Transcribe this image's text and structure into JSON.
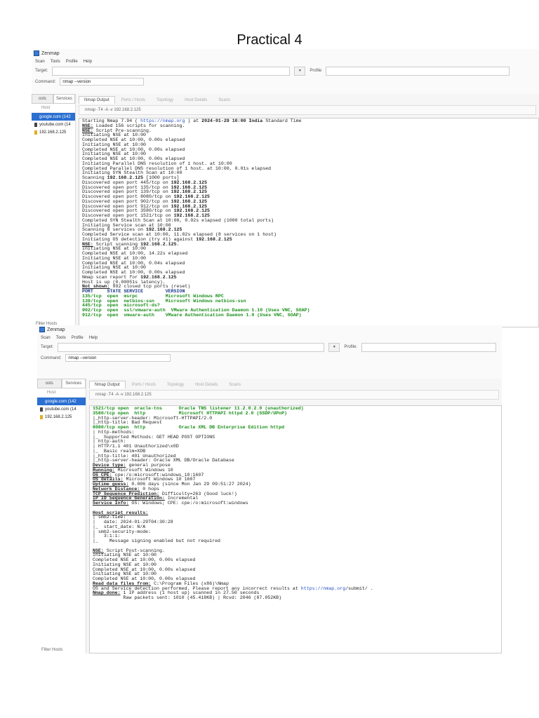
{
  "page_title": "Practical 4",
  "colors": {
    "selection": "#2a6fd1",
    "port_line": "#1a8f1a",
    "link": "#2350c8"
  },
  "screenshots": [
    {
      "window_title": "Zenmap",
      "menu": [
        "Scan",
        "Tools",
        "Profile",
        "Help"
      ],
      "target_label": "Target:",
      "target_value": "",
      "profile_label": "Profile",
      "command_label": "Command:",
      "command_value": "nmap --version",
      "left_tabs": [
        "osts",
        "Services"
      ],
      "host_header": "Host",
      "hosts": [
        {
          "name": "google.com (142",
          "selected": true,
          "icon_color": "#2a6fd1"
        },
        {
          "name": "youtube.com (14",
          "selected": false,
          "icon_color": "#444444"
        },
        {
          "name": "192.168.2.125",
          "selected": false,
          "icon_color": "#e0b020"
        }
      ],
      "filter_label": "Filter Hosts",
      "right_tabs": [
        "Nmap Output",
        "Ports / Hosts",
        "Topology",
        "Host Details",
        "Scans"
      ],
      "command_echo": "nmap -T4 -A -v 192.168.2.125",
      "output_lines": [
        {
          "s": [
            {
              "t": "Starting Nmap 7.94 ( "
            },
            {
              "t": "https://nmap.org",
              "c": "bl"
            },
            {
              "t": " ) at "
            },
            {
              "t": "2024-01-29 10:00 India",
              "c": "b"
            },
            {
              "t": " Standard Time"
            }
          ]
        },
        {
          "s": [
            {
              "t": "NSE:",
              "c": "u"
            },
            {
              "t": " Loaded 156 scripts for scanning."
            }
          ]
        },
        {
          "s": [
            {
              "t": "NSE:",
              "c": "u"
            },
            {
              "t": " Script Pre-scanning."
            }
          ]
        },
        {
          "s": [
            {
              "t": "Initiating NSE at 10:00"
            }
          ]
        },
        {
          "s": [
            {
              "t": "Completed NSE at 10:00, 0.00s elapsed"
            }
          ]
        },
        {
          "s": [
            {
              "t": "Initiating NSE at 10:00"
            }
          ]
        },
        {
          "s": [
            {
              "t": "Completed NSE at 10:00, 0.00s elapsed"
            }
          ]
        },
        {
          "s": [
            {
              "t": "Initiating NSE at 10:00"
            }
          ]
        },
        {
          "s": [
            {
              "t": "Completed NSE at 10:00, 0.00s elapsed"
            }
          ]
        },
        {
          "s": [
            {
              "t": "Initiating Parallel DNS resolution of 1 host. at 10:00"
            }
          ]
        },
        {
          "s": [
            {
              "t": "Completed Parallel DNS resolution of 1 host. at 10:00, 0.01s elapsed"
            }
          ]
        },
        {
          "s": [
            {
              "t": "Initiating SYN Stealth Scan at 10:00"
            }
          ]
        },
        {
          "s": [
            {
              "t": "Scanning "
            },
            {
              "t": "192.168.2.125",
              "c": "b"
            },
            {
              "t": " [1000 ports]"
            }
          ]
        },
        {
          "s": [
            {
              "t": "Discovered open port 445/tcp on "
            },
            {
              "t": "192.168.2.125",
              "c": "b"
            }
          ]
        },
        {
          "s": [
            {
              "t": "Discovered open port 135/tcp on "
            },
            {
              "t": "192.168.2.125",
              "c": "b"
            }
          ]
        },
        {
          "s": [
            {
              "t": "Discovered open port 139/tcp on "
            },
            {
              "t": "192.168.2.125",
              "c": "b"
            }
          ]
        },
        {
          "s": [
            {
              "t": "Discovered open port 8080/tcp on "
            },
            {
              "t": "192.168.2.125",
              "c": "b"
            }
          ]
        },
        {
          "s": [
            {
              "t": "Discovered open port 902/tcp on "
            },
            {
              "t": "192.168.2.125",
              "c": "b"
            }
          ]
        },
        {
          "s": [
            {
              "t": "Discovered open port 912/tcp on "
            },
            {
              "t": "192.168.2.125",
              "c": "b"
            }
          ]
        },
        {
          "s": [
            {
              "t": "Discovered open port 3580/tcp on "
            },
            {
              "t": "192.168.2.125",
              "c": "b"
            }
          ]
        },
        {
          "s": [
            {
              "t": "Discovered open port 1521/tcp on "
            },
            {
              "t": "192.168.2.125",
              "c": "b"
            }
          ]
        },
        {
          "s": [
            {
              "t": "Completed SYN Stealth Scan at 10:00, 0.02s elapsed (1000 total ports)"
            }
          ]
        },
        {
          "s": [
            {
              "t": "Initiating Service scan at 10:00"
            }
          ]
        },
        {
          "s": [
            {
              "t": "Scanning 8 services on "
            },
            {
              "t": "192.168.2.125",
              "c": "b"
            }
          ]
        },
        {
          "s": [
            {
              "t": "Completed Service scan at 10:00, 11.02s elapsed (8 services on 1 host)"
            }
          ]
        },
        {
          "s": [
            {
              "t": "Initiating OS detection (try #1) against "
            },
            {
              "t": "192.168.2.125",
              "c": "b"
            }
          ]
        },
        {
          "s": [
            {
              "t": "NSE:",
              "c": "u"
            },
            {
              "t": " Script scanning "
            },
            {
              "t": "192.168.2.125",
              "c": "b"
            },
            {
              "t": "."
            }
          ]
        },
        {
          "s": [
            {
              "t": "Initiating NSE at 10:00"
            }
          ]
        },
        {
          "s": [
            {
              "t": "Completed NSE at 10:00, 14.22s elapsed"
            }
          ]
        },
        {
          "s": [
            {
              "t": "Initiating NSE at 10:00"
            }
          ]
        },
        {
          "s": [
            {
              "t": "Completed NSE at 10:00, 0.04s elapsed"
            }
          ]
        },
        {
          "s": [
            {
              "t": "Initiating NSE at 10:00"
            }
          ]
        },
        {
          "s": [
            {
              "t": "Completed NSE at 10:00, 0.00s elapsed"
            }
          ]
        },
        {
          "s": [
            {
              "t": "Nmap scan report for "
            },
            {
              "t": "192.168.2.125",
              "c": "b"
            }
          ]
        },
        {
          "s": [
            {
              "t": "Host is up (0.00051s latency)."
            }
          ]
        },
        {
          "s": [
            {
              "t": "Not shown:",
              "c": "u"
            },
            {
              "t": " 992 closed tcp ports (reset)"
            }
          ]
        },
        {
          "s": [
            {
              "t": "PORT     STATE SERVICE        VERSION",
              "c": "blk"
            }
          ]
        },
        {
          "s": [
            {
              "t": "135/tcp  open  msrpc          Microsoft Windows RPC",
              "c": "g"
            }
          ]
        },
        {
          "s": [
            {
              "t": "139/tcp  open  netbios-ssn    Microsoft Windows netbios-ssn",
              "c": "g"
            }
          ]
        },
        {
          "s": [
            {
              "t": "445/tcp  open  microsoft-ds?",
              "c": "g"
            }
          ]
        },
        {
          "s": [
            {
              "t": "902/tcp  open  ssl/vmware-auth  VMware Authentication Daemon 1.10 (Uses VNC, SOAP)",
              "c": "g"
            }
          ]
        },
        {
          "s": [
            {
              "t": "912/tcp  open  vmware-auth    VMware Authentication Daemon 1.0 (Uses VNC, SOAP)",
              "c": "g"
            }
          ]
        }
      ]
    },
    {
      "window_title": "Zenmap",
      "menu": [
        "Scan",
        "Tools",
        "Profile",
        "Help"
      ],
      "target_label": "Target:",
      "target_value": "",
      "profile_label": "Profile:",
      "command_label": "Command:",
      "command_value": "nmap --version",
      "left_tabs": [
        "osts",
        "Services"
      ],
      "host_header": "Host",
      "hosts": [
        {
          "name": "google.com (142",
          "selected": true,
          "icon_color": "#2a6fd1"
        },
        {
          "name": "youtube.com (14",
          "selected": false,
          "icon_color": "#444444"
        },
        {
          "name": "192.168.2.125",
          "selected": false,
          "icon_color": "#e0b020"
        }
      ],
      "filter_label": "Filter Hosts",
      "right_tabs": [
        "Nmap Output",
        "Ports / Hosts",
        "Topology",
        "Host Details",
        "Scans"
      ],
      "command_echo": "nmap -T4 -A -v 192.168.2.125",
      "output_lines": [
        {
          "s": [
            {
              "t": "1521/tcp open  oracle-tns      Oracle TNS listener 11.2.0.2.0 (unauthorized)",
              "c": "g"
            }
          ]
        },
        {
          "s": [
            {
              "t": "3580/tcp open  http            Microsoft HTTPAPI httpd 2.0 (SSDP/UPnP)",
              "c": "g"
            }
          ]
        },
        {
          "s": [
            {
              "t": "|_http-server-header: Microsoft-HTTPAPI/2.0"
            }
          ]
        },
        {
          "s": [
            {
              "t": "|_http-title: Bad Request"
            }
          ]
        },
        {
          "s": [
            {
              "t": "8080/tcp open  http            Oracle XML DB Enterprise Edition httpd",
              "c": "g"
            }
          ]
        },
        {
          "s": [
            {
              "t": "| http-methods:"
            }
          ]
        },
        {
          "s": [
            {
              "t": "|_  Supported Methods: GET HEAD POST OPTIONS"
            }
          ]
        },
        {
          "s": [
            {
              "t": "| http-auth:"
            }
          ]
        },
        {
          "s": [
            {
              "t": "| HTTP/1.1 401 Unauthorized\\x0D"
            }
          ]
        },
        {
          "s": [
            {
              "t": "|_  Basic realm=XDB"
            }
          ]
        },
        {
          "s": [
            {
              "t": "|_http-title: 401 Unauthorized"
            }
          ]
        },
        {
          "s": [
            {
              "t": "|_http-server-header: Oracle XML DB/Oracle Database"
            }
          ]
        },
        {
          "s": [
            {
              "t": "Device type:",
              "c": "u"
            },
            {
              "t": " general purpose"
            }
          ]
        },
        {
          "s": [
            {
              "t": "Running:",
              "c": "u"
            },
            {
              "t": " Microsoft Windows 10"
            }
          ]
        },
        {
          "s": [
            {
              "t": "OS CPE:",
              "c": "u"
            },
            {
              "t": " cpe:/o:microsoft:windows_10:1607"
            }
          ]
        },
        {
          "s": [
            {
              "t": "OS details:",
              "c": "u"
            },
            {
              "t": " Microsoft Windows 10 1607"
            }
          ]
        },
        {
          "s": [
            {
              "t": "Uptime guess:",
              "c": "u"
            },
            {
              "t": " 0.006 days (since Mon Jan 29 09:51:27 2024)"
            }
          ]
        },
        {
          "s": [
            {
              "t": "Network Distance:",
              "c": "u"
            },
            {
              "t": " 0 hops"
            }
          ]
        },
        {
          "s": [
            {
              "t": "TCP Sequence Prediction:",
              "c": "u"
            },
            {
              "t": " Difficulty=263 (Good luck!)"
            }
          ]
        },
        {
          "s": [
            {
              "t": "IP ID Sequence Generation:",
              "c": "u"
            },
            {
              "t": " Incremental"
            }
          ]
        },
        {
          "s": [
            {
              "t": "Service Info:",
              "c": "u"
            },
            {
              "t": " OS: Windows; CPE: cpe:/o:microsoft:windows"
            }
          ]
        },
        {
          "s": [
            {
              "t": " "
            }
          ]
        },
        {
          "s": [
            {
              "t": "Host script results:",
              "c": "u"
            }
          ]
        },
        {
          "s": [
            {
              "t": "| smb2-time:"
            }
          ]
        },
        {
          "s": [
            {
              "t": "|   date: 2024-01-29T04:30:28"
            }
          ]
        },
        {
          "s": [
            {
              "t": "|_  start_date: N/A"
            }
          ]
        },
        {
          "s": [
            {
              "t": "| smb2-security-mode:"
            }
          ]
        },
        {
          "s": [
            {
              "t": "|   3:1:1:"
            }
          ]
        },
        {
          "s": [
            {
              "t": "|_    Message signing enabled but not required"
            }
          ]
        },
        {
          "s": [
            {
              "t": " "
            }
          ]
        },
        {
          "s": [
            {
              "t": "NSE:",
              "c": "u"
            },
            {
              "t": " Script Post-scanning."
            }
          ]
        },
        {
          "s": [
            {
              "t": "Initiating NSE at 10:00"
            }
          ]
        },
        {
          "s": [
            {
              "t": "Completed NSE at 10:00, 0.00s elapsed"
            }
          ]
        },
        {
          "s": [
            {
              "t": "Initiating NSE at 10:00"
            }
          ]
        },
        {
          "s": [
            {
              "t": "Completed NSE at 10:00, 0.00s elapsed"
            }
          ]
        },
        {
          "s": [
            {
              "t": "Initiating NSE at 10:00"
            }
          ]
        },
        {
          "s": [
            {
              "t": "Completed NSE at 10:00, 0.00s elapsed"
            }
          ]
        },
        {
          "s": [
            {
              "t": "Read data files from:",
              "c": "u"
            },
            {
              "t": " C:\\Program Files (x86)\\Nmap"
            }
          ]
        },
        {
          "s": [
            {
              "t": "OS and Service detection performed. Please report any incorrect results at "
            },
            {
              "t": "https://nmap.org",
              "c": "bl"
            },
            {
              "t": "/submit/ ."
            }
          ]
        },
        {
          "s": [
            {
              "t": "Nmap done:",
              "c": "u"
            },
            {
              "t": " 1 IP address (1 host up) scanned in 27.50 seconds"
            }
          ]
        },
        {
          "s": [
            {
              "t": "           Raw packets sent: 1010 (45.418KB) | Rcvd: 2046 (87.052KB)"
            }
          ]
        }
      ]
    }
  ]
}
